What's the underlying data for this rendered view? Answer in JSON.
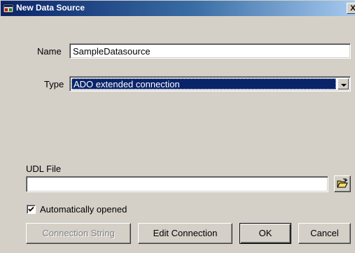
{
  "window": {
    "title": "New Data Source",
    "close_glyph": "X"
  },
  "name_field": {
    "label": "Name",
    "value": "SampleDatasource"
  },
  "type_field": {
    "label": "Type",
    "selected": "ADO extended connection"
  },
  "udl_field": {
    "label": "UDL File",
    "value": ""
  },
  "auto_open": {
    "label": "Automatically opened",
    "checked": true
  },
  "buttons": {
    "connection_string": "Connection String",
    "edit_connection": "Edit Connection",
    "ok": "OK",
    "cancel": "Cancel"
  },
  "icons": {
    "title_icon": "data-source-icon",
    "browse_icon": "folder-open-icon",
    "dropdown_icon": "chevron-down-icon",
    "check_icon": "checkmark-icon"
  },
  "colors": {
    "titlebar_start": "#0a246a",
    "titlebar_end": "#a6caf0",
    "selection": "#0a246a",
    "dialog_bg": "#d4d0c8"
  }
}
